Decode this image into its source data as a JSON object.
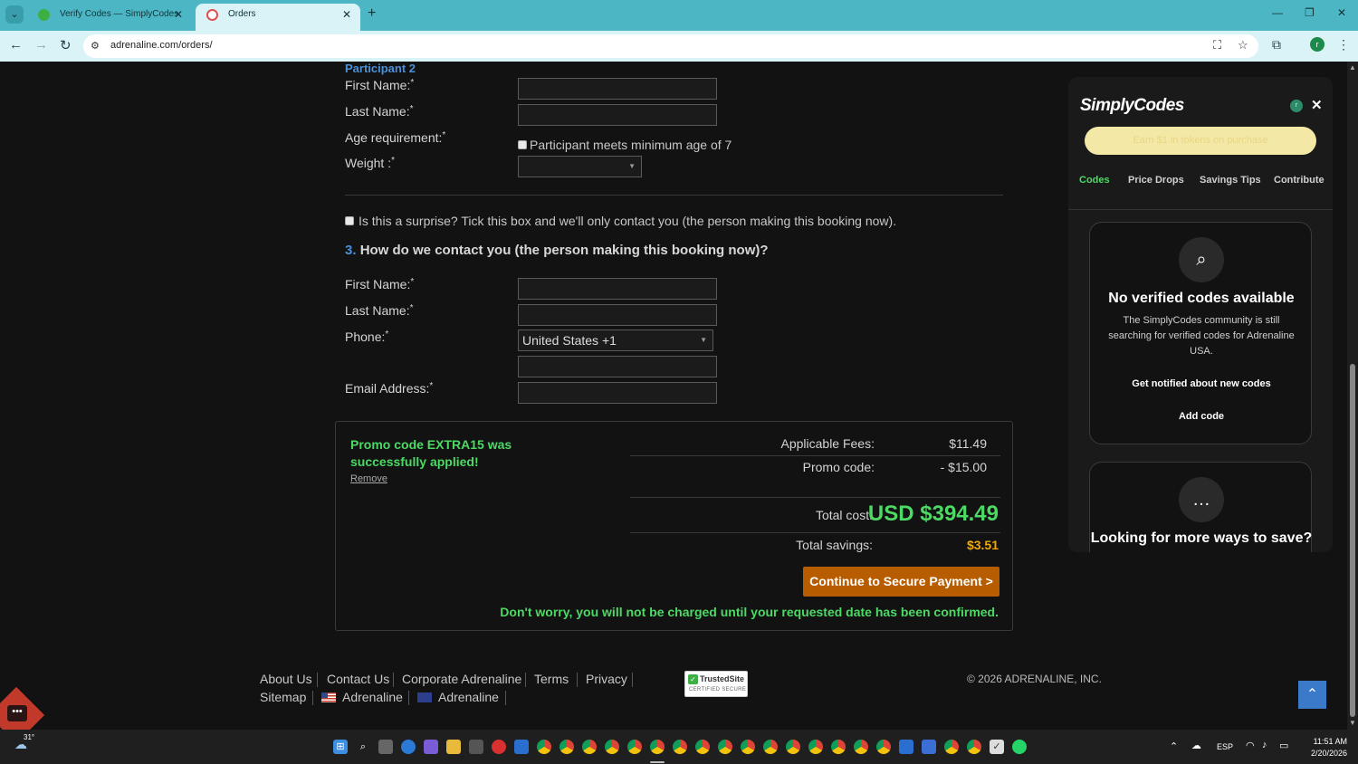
{
  "browser": {
    "tabs": [
      {
        "title": "Verify Codes — SimplyCodes",
        "active": false
      },
      {
        "title": "Orders",
        "active": true
      }
    ],
    "url": "adrenaline.com/orders/"
  },
  "form": {
    "participant_title": "Participant 2",
    "p2_first_name": "First Name:",
    "p2_last_name": "Last Name:",
    "age_requirement": "Age requirement:",
    "age_checkbox_text": "Participant meets minimum age of 7",
    "weight": "Weight :",
    "required_mark": "*",
    "surprise_text": "Is this a surprise? Tick this box and we'll only contact you (the person making this booking now).",
    "section3_num": "3.",
    "section3_title": "How do we contact you (the person making this booking now)?",
    "first_name": "First Name:",
    "last_name": "Last Name:",
    "phone": "Phone:",
    "phone_country": "United States +1",
    "email": "Email Address:"
  },
  "summary": {
    "promo_message": "Promo code EXTRA15 was successfully applied!",
    "remove": "Remove",
    "fees_label": "Applicable Fees:",
    "fees_value": "$11.49",
    "promo_label": "Promo code:",
    "promo_value": "- $15.00",
    "total_label": "Total cost:",
    "total_value": "USD $394.49",
    "savings_label": "Total savings:",
    "savings_value": "$3.51",
    "pay_button": "Continue to Secure Payment >",
    "worry_text": "Don't worry, you will not be charged until your requested date has been confirmed."
  },
  "footer": {
    "links": [
      "About Us",
      "Contact Us",
      "Corporate Adrenaline",
      "Terms",
      "Privacy"
    ],
    "sitemap": "Sitemap",
    "adrenaline_us": "Adrenaline",
    "adrenaline_au": "Adrenaline",
    "trusted_1": "TrustedSite",
    "trusted_2": "CERTIFIED SECURE",
    "copyright": "© 2026 ADRENALINE, INC."
  },
  "simplycodes": {
    "logo": "SimplyCodes",
    "earn": "Earn $1 in tokens on purchase",
    "tabs": [
      "Codes",
      "Price Drops",
      "Savings Tips",
      "Contribute"
    ],
    "no_codes_title": "No verified codes available",
    "no_codes_text": "The SimplyCodes community is still searching for verified codes for Adrenaline USA.",
    "notify": "Get notified about new codes",
    "add_code": "Add code",
    "more_ways": "Looking for more ways to save?"
  },
  "taskbar": {
    "temperature": "31°",
    "language": "ESP",
    "time": "11:51 AM",
    "date": "2/20/2026"
  },
  "colors": {
    "accent_green": "#4cd964",
    "pay_button": "#b85c00",
    "link_blue": "#4a90d9",
    "savings_orange": "#f2a900"
  }
}
